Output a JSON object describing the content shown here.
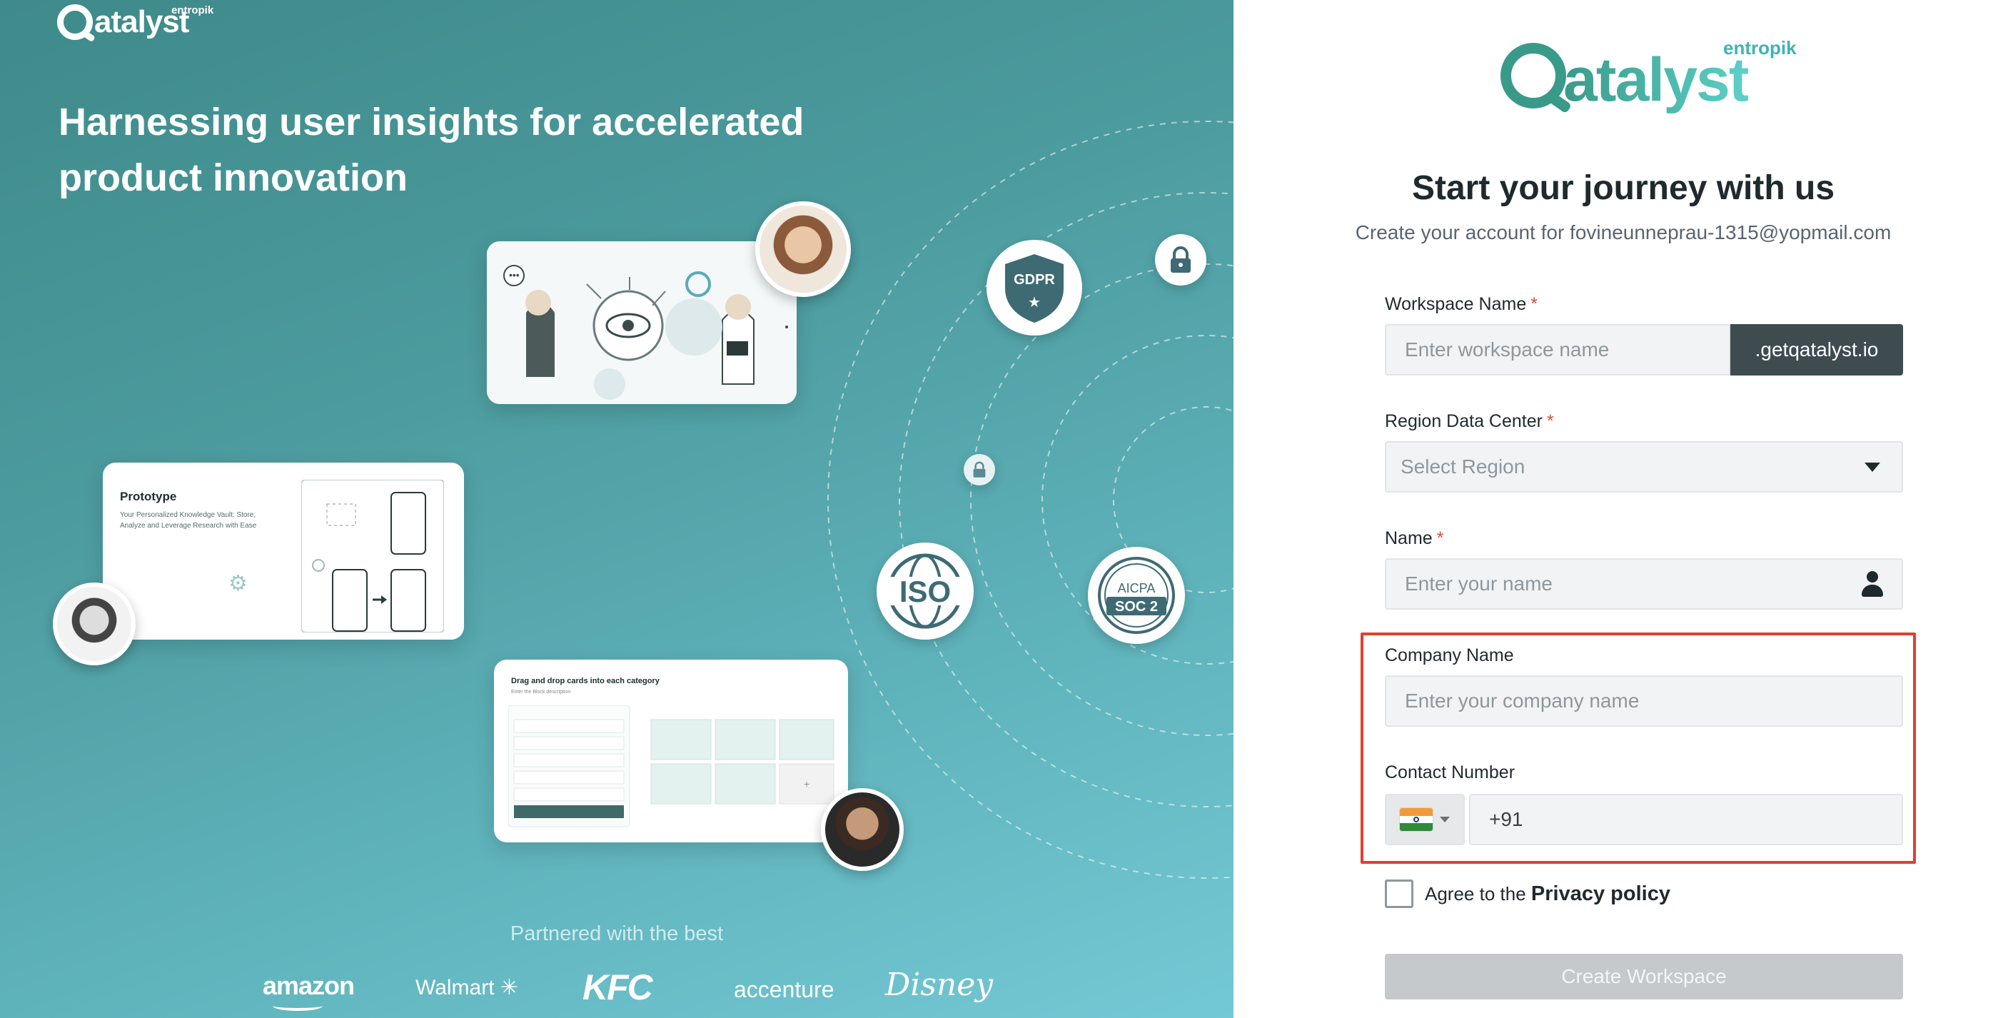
{
  "left_panel": {
    "logo_word": "atalyst",
    "logo_sub": "entropik",
    "headline": "Harnessing user insights for accelerated product innovation",
    "prototype_card": {
      "title": "Prototype",
      "description": "Your Personalized Knowledge Vault: Store, Analyze and Leverage Research with Ease"
    },
    "drag_card": {
      "title": "Drag and drop cards into each category",
      "subtitle": "Enter the Block description"
    },
    "badges": {
      "gdpr": "GDPR",
      "iso": "ISO",
      "aicpa": "AICPA",
      "soc2": "SOC 2"
    },
    "partnered_text": "Partnered with the best",
    "brands": [
      "amazon",
      "Walmart",
      "KFC",
      "accenture",
      "Disney"
    ]
  },
  "right_panel": {
    "logo_word": "atalyst",
    "logo_sub": "entropik",
    "title": "Start your journey with us",
    "subtitle": "Create your account for fovineunneprau-1315@yopmail.com",
    "workspace": {
      "label": "Workspace Name",
      "placeholder": "Enter workspace name",
      "suffix": ".getqatalyst.io"
    },
    "region": {
      "label": "Region Data Center",
      "placeholder": "Select Region"
    },
    "name": {
      "label": "Name",
      "placeholder": "Enter your name"
    },
    "company": {
      "label": "Company Name",
      "placeholder": "Enter your company name"
    },
    "contact": {
      "label": "Contact Number",
      "country_code": "+91"
    },
    "agree": {
      "text": "Agree to the",
      "link": "Privacy policy"
    },
    "submit_label": "Create Workspace",
    "required_mark": "*"
  },
  "colors": {
    "left_gradient_start": "#3f8a8a",
    "left_gradient_end": "#74c9d6",
    "brand_teal": "#3a9a8a",
    "suffix_bg": "#3e4c50",
    "highlight_border": "#e0402f",
    "button_disabled": "#c5c9cc"
  }
}
